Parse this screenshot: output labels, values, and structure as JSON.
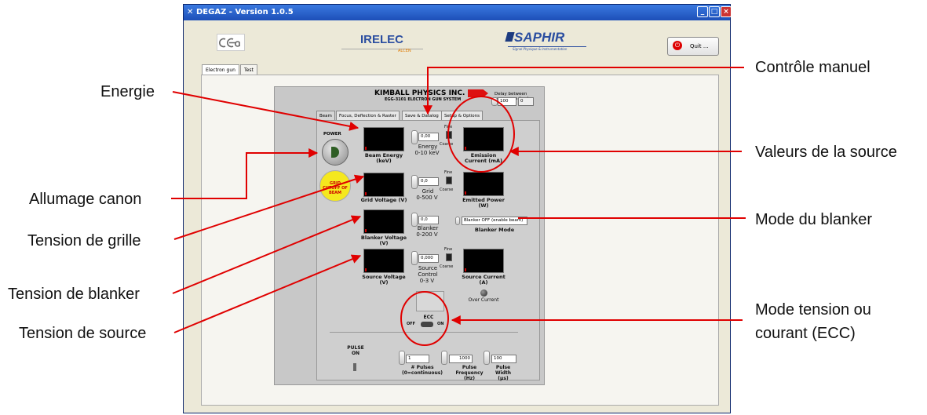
{
  "window": {
    "title": "DEGAZ - Version 1.0.5"
  },
  "logos": {
    "cea": "cea",
    "irelec": "IRELEC",
    "irelec_sub": "ALCEN",
    "saphir": "SAPHIR",
    "saphir_sub": "Signal Physique & Instrumentation"
  },
  "quit_label": "Quit ...",
  "tabs": [
    "Electron gun",
    "Test"
  ],
  "panel": {
    "company": "KIMBALL PHYSICS INC.",
    "system": "EGG-3101 ELECTRON GUN SYSTEM",
    "delay_label": "Delay between sequences (ms)",
    "delay_value": "100",
    "delay_readout": "0",
    "tabs": [
      "Beam",
      "Focus, Deflection & Raster",
      "Save & Datalog",
      "Setup & Options"
    ],
    "power_label": "POWER",
    "grid_cutoff_label": "GRID CUTOFF OF BEAM",
    "energy": {
      "value": "0,00",
      "ctl": "Energy",
      "range": "0-10 keV",
      "meter": "Beam Energy (keV)"
    },
    "grid": {
      "value": "0,0",
      "ctl": "Grid",
      "range": "0-500 V",
      "meter": "Grid Voltage (V)"
    },
    "blanker": {
      "value": "0,0",
      "ctl": "Blanker",
      "range": "0-200 V",
      "meter": "Blanker Voltage (V)"
    },
    "source": {
      "value": "0,000",
      "ctl1": "Source",
      "ctl2": "Control",
      "range": "0-3 V",
      "meter": "Source Voltage (V)"
    },
    "fine": "Fine",
    "coarse": "Coarse",
    "emission": "Emission Current (mA)",
    "emitted": "Emitted Power (W)",
    "blanker_mode_value": "Blanker OFF (enable beam)",
    "blanker_mode_label": "Blanker Mode",
    "source_current": "Source Current (A)",
    "over_current": "Over Current",
    "ecc": "ECC",
    "off": "OFF",
    "on": "ON",
    "pulse_on": "PULSE ON",
    "pulses_value": "1",
    "pulses_label": "# Pulses (0=continuous)",
    "freq_value": "1000",
    "freq_label": "Pulse Frequency (Hz)",
    "width_value": "100",
    "width_label": "Pulse Width (µs)"
  },
  "annotations": {
    "energie": "Energie",
    "allumage": "Allumage canon",
    "grille": "Tension de grille",
    "blanker": "Tension de blanker",
    "source": "Tension de source",
    "controle": "Contrôle manuel",
    "valeurs": "Valeurs de la source",
    "mode_blanker": "Mode du blanker",
    "ecc_line1": "Mode tension ou",
    "ecc_line2": "courant (ECC)"
  },
  "colors": {
    "annotation": "#e00000",
    "title_bar": "#1d4fb8",
    "panel": "#c8c8c8"
  }
}
